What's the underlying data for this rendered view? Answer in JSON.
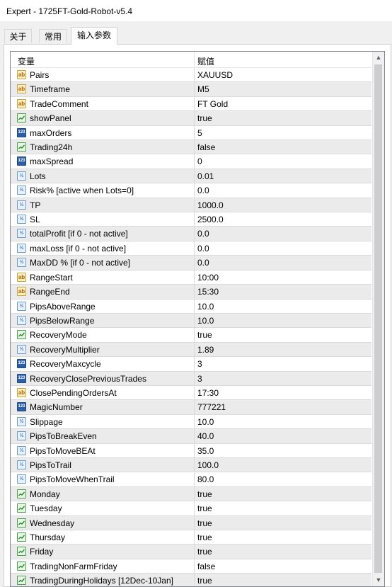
{
  "window": {
    "title": "Expert - 1725FT-Gold-Robot-v5.4"
  },
  "tabs": [
    {
      "label": "关于"
    },
    {
      "label": "常用"
    },
    {
      "label": "输入参数"
    }
  ],
  "table": {
    "columns": {
      "variable": "变量",
      "value": "赋值"
    },
    "rows": [
      {
        "icon": "ab",
        "name": "Pairs",
        "value": "XAUUSD"
      },
      {
        "icon": "ab",
        "name": "Timeframe",
        "value": "M5"
      },
      {
        "icon": "ab",
        "name": "TradeComment",
        "value": "FT Gold"
      },
      {
        "icon": "bool",
        "name": "showPanel",
        "value": "true"
      },
      {
        "icon": "123",
        "name": "maxOrders",
        "value": "5"
      },
      {
        "icon": "bool",
        "name": "Trading24h",
        "value": "false"
      },
      {
        "icon": "123",
        "name": "maxSpread",
        "value": "0"
      },
      {
        "icon": "v2",
        "name": "Lots",
        "value": "0.01"
      },
      {
        "icon": "v2",
        "name": "Risk% [active when Lots=0]",
        "value": "0.0"
      },
      {
        "icon": "v2",
        "name": "TP",
        "value": "1000.0"
      },
      {
        "icon": "v2",
        "name": "SL",
        "value": "2500.0"
      },
      {
        "icon": "v2",
        "name": "totalProfit [if 0 - not active]",
        "value": "0.0"
      },
      {
        "icon": "v2",
        "name": "maxLoss [if 0 - not active]",
        "value": "0.0"
      },
      {
        "icon": "v2",
        "name": "MaxDD % [if 0 - not active]",
        "value": "0.0"
      },
      {
        "icon": "ab",
        "name": "RangeStart",
        "value": "10:00"
      },
      {
        "icon": "ab",
        "name": "RangeEnd",
        "value": "15:30"
      },
      {
        "icon": "v2",
        "name": "PipsAboveRange",
        "value": "10.0"
      },
      {
        "icon": "v2",
        "name": "PipsBelowRange",
        "value": "10.0"
      },
      {
        "icon": "bool",
        "name": "RecoveryMode",
        "value": "true"
      },
      {
        "icon": "v2",
        "name": "RecoveryMultiplier",
        "value": "1.89"
      },
      {
        "icon": "123",
        "name": "RecoveryMaxcycle",
        "value": "3"
      },
      {
        "icon": "123",
        "name": "RecoveryClosePreviousTrades",
        "value": "3"
      },
      {
        "icon": "ab",
        "name": "ClosePendingOrdersAt",
        "value": "17:30"
      },
      {
        "icon": "123",
        "name": "MagicNumber",
        "value": "777221"
      },
      {
        "icon": "v2",
        "name": "Slippage",
        "value": "10.0"
      },
      {
        "icon": "v2",
        "name": "PipsToBreakEven",
        "value": "40.0"
      },
      {
        "icon": "v2",
        "name": "PipsToMoveBEAt",
        "value": "35.0"
      },
      {
        "icon": "v2",
        "name": "PipsToTrail",
        "value": "100.0"
      },
      {
        "icon": "v2",
        "name": "PipsToMoveWhenTrail",
        "value": "80.0"
      },
      {
        "icon": "bool",
        "name": "Monday",
        "value": "true"
      },
      {
        "icon": "bool",
        "name": "Tuesday",
        "value": "true"
      },
      {
        "icon": "bool",
        "name": "Wednesday",
        "value": "true"
      },
      {
        "icon": "bool",
        "name": "Thursday",
        "value": "true"
      },
      {
        "icon": "bool",
        "name": "Friday",
        "value": "true"
      },
      {
        "icon": "bool",
        "name": "TradingNonFarmFriday",
        "value": "false"
      },
      {
        "icon": "bool",
        "name": "TradingDuringHolidays [12Dec-10Jan]",
        "value": "true"
      }
    ]
  },
  "icon_labels": {
    "ab": "ab",
    "123": "123",
    "v2": "½"
  }
}
